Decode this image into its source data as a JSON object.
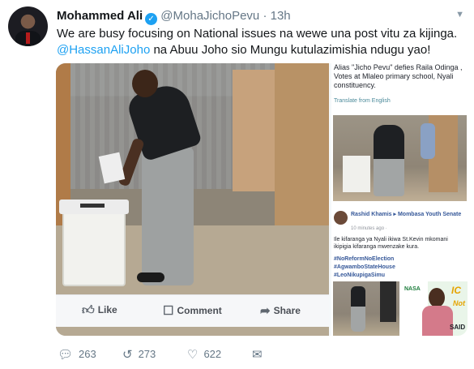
{
  "author": {
    "name": "Mohammed Ali",
    "handle": "@MohaJichoPevu",
    "separator": "·",
    "time": "13h"
  },
  "tweet": {
    "text_line1": "We are busy focusing on National issues na wewe una post vitu za kijinga.",
    "mention": "@HassanAliJoho",
    "text_line2_rest": " na Abuu Joho sio Mungu kutulazimishia ndugu yao!"
  },
  "embedded_facebook": {
    "actions": [
      "Like",
      "Comment",
      "Share"
    ]
  },
  "right_column": {
    "caption": "Alias \"Jicho Pevu\" defies Raila Odinga , Votes at Mlaleo primary school, Nyali constituency.",
    "translate": "Translate from English",
    "post": {
      "author": "Rashid Khamis ▸ Mombasa Youth Senate",
      "time": "10 minutes ago ·",
      "body": "Ile kifaranga ya Nyali ikiwa St.Kevin mkomani ikipigia kifaranga mwenzake kura.",
      "hashtags": [
        "#NoReformNoElection",
        "#AgwamboStateHouse",
        "#LeoNikupigaSimu"
      ],
      "image_text": {
        "nasa": "NASA",
        "top": "IC",
        "mid": "Not",
        "name": "SAID"
      }
    }
  },
  "actions": {
    "replies": "263",
    "retweets": "273",
    "likes": "622"
  },
  "icons": {
    "reply": "reply-icon",
    "retweet": "retweet-icon",
    "like": "heart-icon",
    "dm": "envelope-icon",
    "verified": "verified-badge-icon",
    "caret": "chevron-down-icon"
  },
  "colors": {
    "link": "#1da1f2",
    "muted": "#657786",
    "verified": "#1da1f2",
    "facebook_link": "#365899"
  }
}
